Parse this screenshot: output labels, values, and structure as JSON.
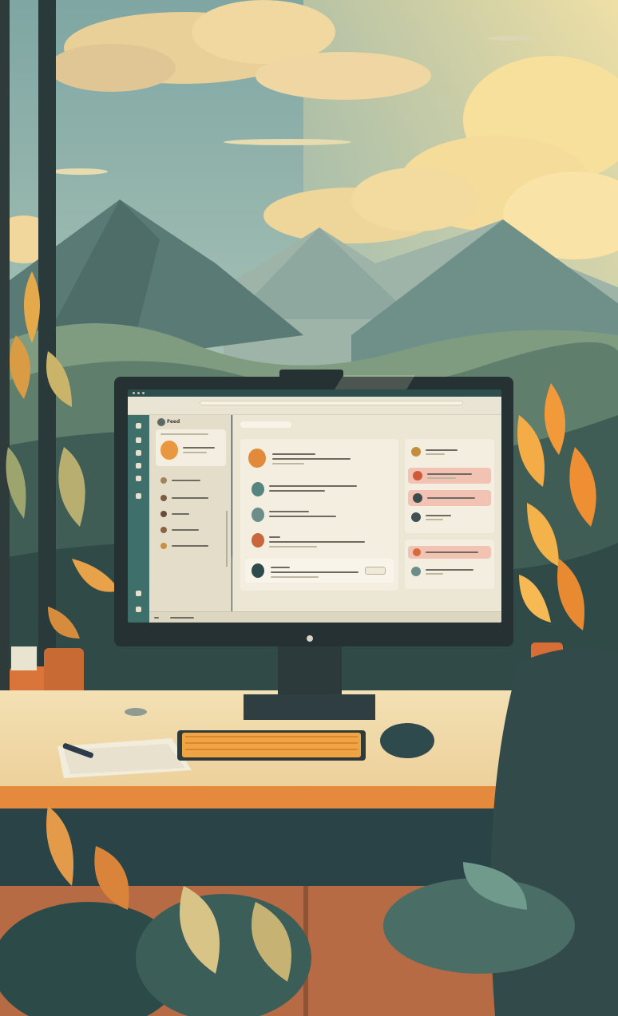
{
  "scene": {
    "description_free": true,
    "sky_color": "#8fb3ad",
    "cloud_color": "#f0d79a",
    "mountain_color": "#4f6f6a",
    "desk_color": "#f0d9ac",
    "accent_orange": "#e98a3a"
  },
  "screen": {
    "sidebar_title": "Feed",
    "address_label": "",
    "nav_label": "",
    "button_label": "",
    "status_label": ""
  }
}
